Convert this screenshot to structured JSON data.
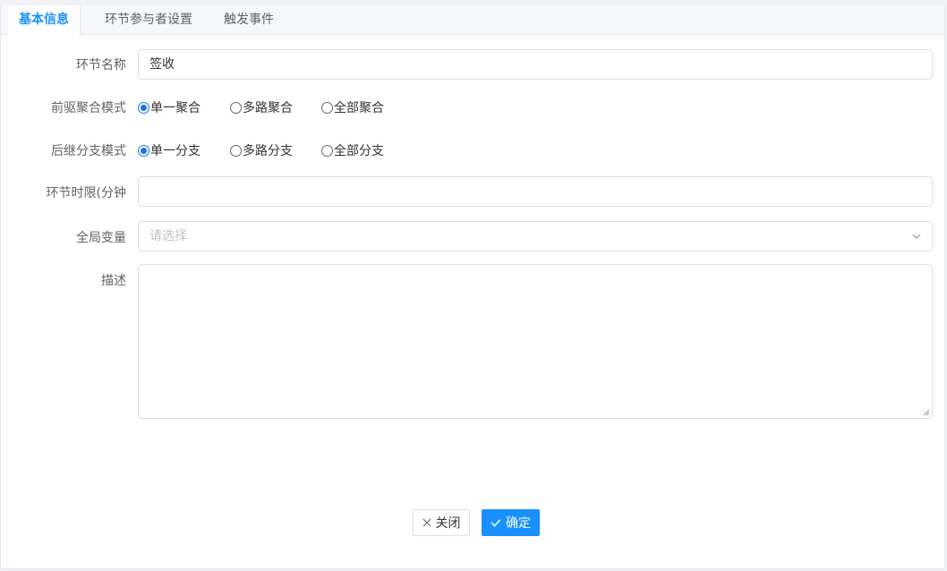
{
  "tabs": [
    {
      "label": "基本信息",
      "active": true
    },
    {
      "label": "环节参与者设置",
      "active": false
    },
    {
      "label": "触发事件",
      "active": false
    }
  ],
  "form": {
    "name": {
      "label": "环节名称",
      "value": "签收"
    },
    "pre_mode": {
      "label": "前驱聚合模式",
      "options": [
        "单一聚合",
        "多路聚合",
        "全部聚合"
      ],
      "selected": "单一聚合"
    },
    "post_mode": {
      "label": "后继分支模式",
      "options": [
        "单一分支",
        "多路分支",
        "全部分支"
      ],
      "selected": "单一分支"
    },
    "time_limit": {
      "label": "环节时限(分钟",
      "value": ""
    },
    "global_var": {
      "label": "全局变量",
      "placeholder": "请选择"
    },
    "description": {
      "label": "描述",
      "value": ""
    }
  },
  "buttons": {
    "close": {
      "label": "关闭",
      "icon": "close-icon"
    },
    "confirm": {
      "label": "确定",
      "icon": "check-icon"
    }
  },
  "colors": {
    "accent": "#1890ff",
    "border": "#dcdfe6",
    "label": "#606266"
  }
}
